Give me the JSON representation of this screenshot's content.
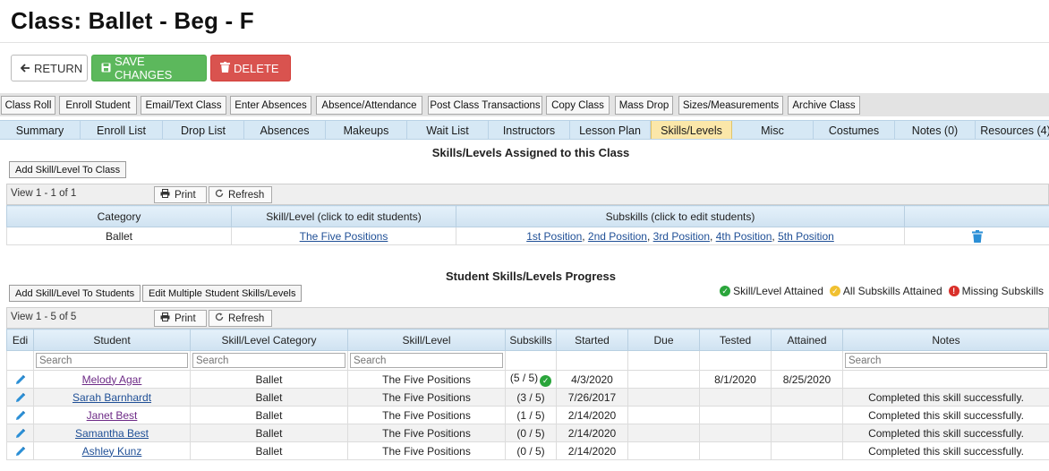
{
  "page": {
    "title": "Class: Ballet - Beg - F"
  },
  "top_actions": {
    "return_label": "RETURN",
    "save_label": "SAVE CHANGES",
    "delete_label": "DELETE"
  },
  "action_bar": [
    "Class Roll",
    "Enroll Student",
    "Email/Text Class",
    "Enter Absences",
    "Absence/Attendance",
    "Post Class Transactions",
    "Copy Class",
    "Mass Drop",
    "Sizes/Measurements",
    "Archive Class"
  ],
  "tabs": [
    "Summary",
    "Enroll List",
    "Drop List",
    "Absences",
    "Makeups",
    "Wait List",
    "Instructors",
    "Lesson Plan",
    "Skills/Levels",
    "Misc",
    "Costumes",
    "Notes (0)",
    "Resources (4)"
  ],
  "active_tab": "Skills/Levels",
  "assigned": {
    "heading": "Skills/Levels Assigned to this Class",
    "add_button": "Add Skill/Level To Class",
    "view_text": "View 1 - 1 of 1",
    "print_label": "Print",
    "refresh_label": "Refresh",
    "columns": [
      "Category",
      "Skill/Level (click to edit students)",
      "Subskills (click to edit students)",
      ""
    ],
    "rows": [
      {
        "category": "Ballet",
        "skill": "The Five Positions",
        "subskills": [
          "1st Position",
          "2nd Position",
          "3rd Position",
          "4th Position",
          "5th Position"
        ]
      }
    ]
  },
  "progress": {
    "heading": "Student Skills/Levels Progress",
    "add_button": "Add Skill/Level To Students",
    "edit_multiple_button": "Edit Multiple Student Skills/Levels",
    "legend": {
      "attained": "Skill/Level Attained",
      "all_subskills": "All Subskills Attained",
      "missing": "Missing Subskills"
    },
    "view_text": "View 1 - 5 of 5",
    "print_label": "Print",
    "refresh_label": "Refresh",
    "search_placeholder": "Search",
    "columns": [
      "Edi",
      "Student",
      "Skill/Level Category",
      "Skill/Level",
      "Subskills",
      "Started",
      "Due",
      "Tested",
      "Attained",
      "Notes"
    ],
    "rows": [
      {
        "student": "Melody Agar",
        "category": "Ballet",
        "skill": "The Five Positions",
        "subskills": "(5 / 5)",
        "complete": true,
        "started": "4/3/2020",
        "due": "",
        "tested": "8/1/2020",
        "attained": "8/25/2020",
        "notes": ""
      },
      {
        "student": "Sarah Barnhardt",
        "category": "Ballet",
        "skill": "The Five Positions",
        "subskills": "(3 / 5)",
        "complete": false,
        "started": "7/26/2017",
        "due": "",
        "tested": "",
        "attained": "",
        "notes": "Completed this skill successfully."
      },
      {
        "student": "Janet Best",
        "category": "Ballet",
        "skill": "The Five Positions",
        "subskills": "(1 / 5)",
        "complete": false,
        "started": "2/14/2020",
        "due": "",
        "tested": "",
        "attained": "",
        "notes": "Completed this skill successfully."
      },
      {
        "student": "Samantha Best",
        "category": "Ballet",
        "skill": "The Five Positions",
        "subskills": "(0 / 5)",
        "complete": false,
        "started": "2/14/2020",
        "due": "",
        "tested": "",
        "attained": "",
        "notes": "Completed this skill successfully."
      },
      {
        "student": "Ashley Kunz",
        "category": "Ballet",
        "skill": "The Five Positions",
        "subskills": "(0 / 5)",
        "complete": false,
        "started": "2/14/2020",
        "due": "",
        "tested": "",
        "attained": "",
        "notes": "Completed this skill successfully."
      }
    ]
  },
  "colors": {
    "save": "#5cb85c",
    "delete": "#d9534f",
    "tab_bar": "#d6e8f5",
    "active_tab": "#fbe7a9",
    "link": "#1f4f96",
    "attained": "#2aa53b",
    "all_subskills": "#f0c030",
    "missing": "#d9302a"
  }
}
